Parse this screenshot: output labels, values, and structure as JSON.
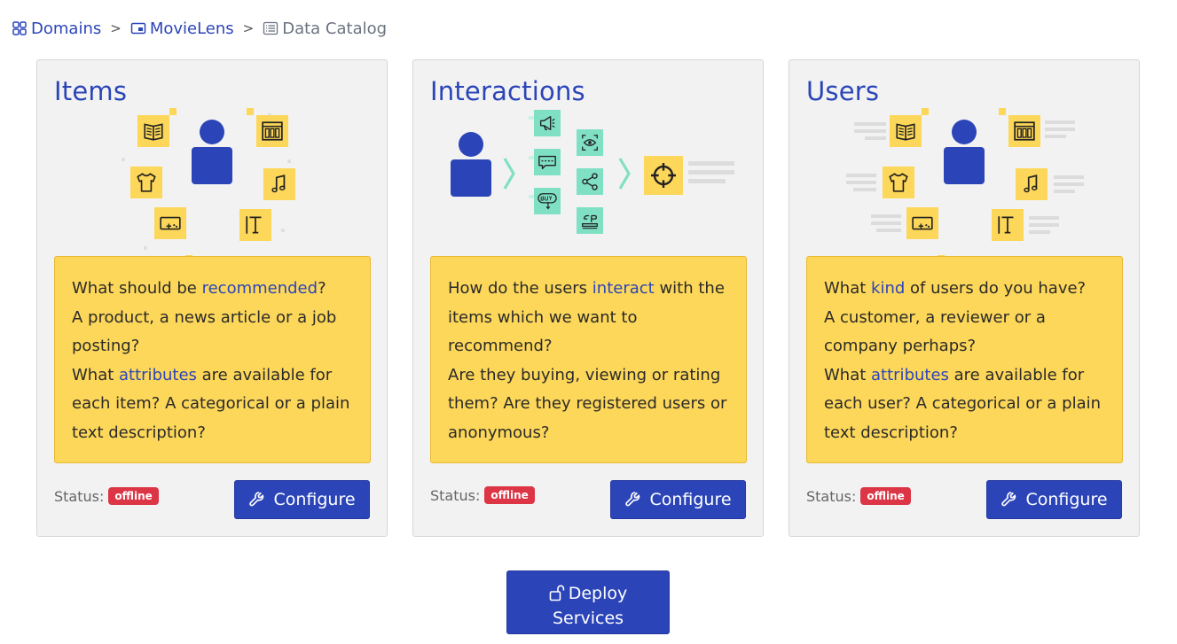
{
  "breadcrumb": {
    "items": [
      {
        "label": "Domains",
        "icon": "grid-icon"
      },
      {
        "label": "MovieLens",
        "icon": "window-icon"
      },
      {
        "label": "Data Catalog",
        "icon": "list-icon"
      }
    ],
    "separator": ">"
  },
  "cards": [
    {
      "title": "Items",
      "lines": [
        [
          "What should be ",
          "recommended",
          "?"
        ],
        [
          "A product, a news article or a job posting?"
        ],
        [
          "What ",
          "attributes",
          " are available for each item? A categorical or a plain text description?"
        ]
      ],
      "status_label": "Status:",
      "status_value": "offline",
      "button_label": "Configure"
    },
    {
      "title": "Interactions",
      "lines": [
        [
          "How do the users ",
          "interact",
          " with the items which we want to recommend?"
        ],
        [
          "Are they buying, viewing or rating them? Are they registered users or anonymous?"
        ]
      ],
      "status_label": "Status:",
      "status_value": "offline",
      "button_label": "Configure"
    },
    {
      "title": "Users",
      "lines": [
        [
          "What ",
          "kind",
          " of users do you have?"
        ],
        [
          "A customer, a reviewer or a company perhaps?"
        ],
        [
          "What ",
          "attributes",
          " are available for each user? A categorical or a plain text description?"
        ]
      ],
      "status_label": "Status:",
      "status_value": "offline",
      "button_label": "Configure"
    }
  ],
  "deploy": {
    "line1": "Deploy",
    "line2": "Services",
    "icon": "unlock-icon"
  },
  "colors": {
    "accent": "#2b45b8",
    "note_bg": "#fdd759",
    "badge": "#dc3545",
    "icon_teal": "#7fe0c4",
    "card_bg": "#f2f2f2"
  }
}
